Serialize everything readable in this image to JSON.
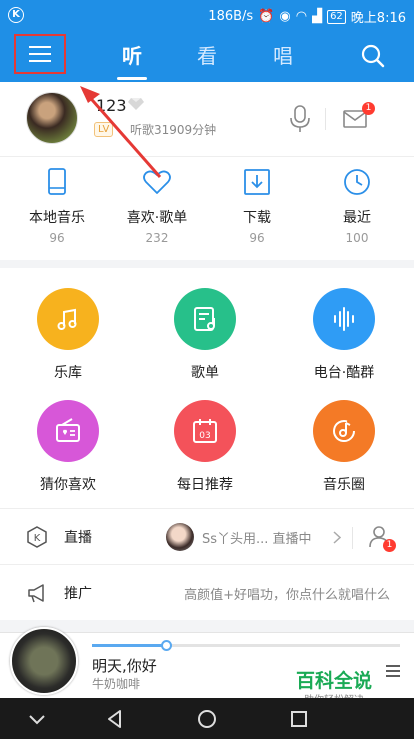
{
  "status_bar": {
    "app_badge": "K",
    "network_speed": "186B/s",
    "battery": "62",
    "time": "晚上8:16"
  },
  "top_tabs": [
    "听",
    "看",
    "唱"
  ],
  "active_tab": "听",
  "profile": {
    "username": "123",
    "level_badge": "LV",
    "listen_time": "听歌31909分钟",
    "mail_badge": "1"
  },
  "shortcuts": [
    {
      "label": "本地音乐",
      "count": "96",
      "icon": "phone-icon"
    },
    {
      "label": "喜欢·歌单",
      "count": "232",
      "icon": "heart-icon"
    },
    {
      "label": "下载",
      "count": "96",
      "icon": "download-icon"
    },
    {
      "label": "最近",
      "count": "100",
      "icon": "clock-icon"
    }
  ],
  "features": [
    {
      "label": "乐库",
      "icon": "music-note-icon",
      "color": "#f7b21e"
    },
    {
      "label": "歌单",
      "icon": "songlist-icon",
      "color": "#27c08a"
    },
    {
      "label": "电台·酷群",
      "icon": "soundwave-icon",
      "color": "#2f9cf5"
    },
    {
      "label": "猜你喜欢",
      "icon": "radio-icon",
      "color": "#d757d8"
    },
    {
      "label": "每日推荐",
      "icon": "calendar-icon",
      "color": "#f4525a"
    },
    {
      "label": "音乐圈",
      "icon": "disc-note-icon",
      "color": "#f47a26"
    }
  ],
  "daily_date": "03",
  "live_row": {
    "title": "直播",
    "text": "Ss丫头用... 直播中",
    "badge": "1"
  },
  "promo_row": {
    "title": "推广",
    "text": "高颜值+好唱功，你点什么就唱什么"
  },
  "player": {
    "song": "明天,你好",
    "artist": "牛奶咖啡",
    "progress": 0.24
  },
  "watermark": {
    "title": "百科全说",
    "subtitle": "助你轻松解决"
  },
  "colors": {
    "brand_blue": "#1f8fe6",
    "highlight_red": "#e53935"
  }
}
